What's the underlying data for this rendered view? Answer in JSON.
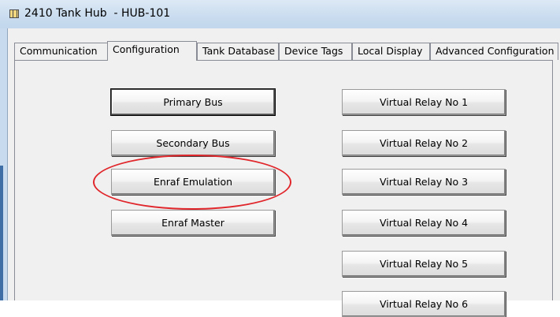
{
  "window": {
    "title": "2410 Tank Hub  - HUB-101"
  },
  "tabs": [
    {
      "label": "Communication",
      "active": false
    },
    {
      "label": "Configuration",
      "active": true
    },
    {
      "label": "Tank Database",
      "active": false
    },
    {
      "label": "Device Tags",
      "active": false
    },
    {
      "label": "Local Display",
      "active": false
    },
    {
      "label": "Advanced Configuration",
      "active": false
    }
  ],
  "left_buttons": [
    {
      "label": "Primary Bus"
    },
    {
      "label": "Secondary Bus"
    },
    {
      "label": "Enraf Emulation"
    },
    {
      "label": "Enraf Master"
    }
  ],
  "right_buttons": [
    {
      "label": "Virtual Relay No 1"
    },
    {
      "label": "Virtual Relay No 2"
    },
    {
      "label": "Virtual Relay No 3"
    },
    {
      "label": "Virtual Relay No 4"
    },
    {
      "label": "Virtual Relay No 5"
    },
    {
      "label": "Virtual Relay No 6"
    }
  ],
  "annotation": {
    "highlighted": "Enraf Emulation",
    "color": "#e0262b"
  },
  "icons": {
    "window_icon": "app-window-icon"
  }
}
